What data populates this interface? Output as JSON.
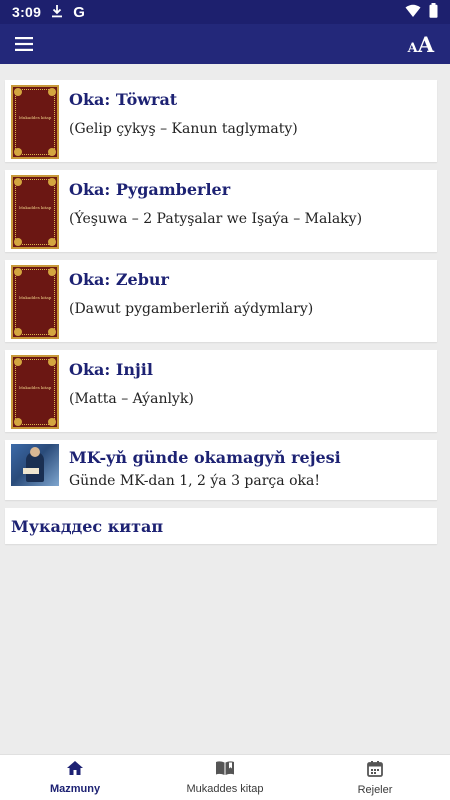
{
  "status_bar": {
    "time": "3:09",
    "icons": [
      "download-icon",
      "google-g-icon",
      "wifi-icon",
      "battery-icon"
    ],
    "g_letter": "G"
  },
  "app_bar": {
    "menu_icon": "hamburger-menu-icon",
    "font_size_small": "A",
    "font_size_big": "A"
  },
  "colors": {
    "primary": "#23287a",
    "status": "#1d206e",
    "title_text": "#1d2273",
    "background": "#ececec"
  },
  "cards": [
    {
      "title": "Oka: Töwrat",
      "subtitle": "(Gelip çykyş – Kanun taglymaty)",
      "cover_text": "Mukaddes kitap"
    },
    {
      "title": "Oka: Pygamberler",
      "subtitle": "(Ýeşuwa – 2 Patyşalar we Işaýa – Malaky)",
      "cover_text": "Mukaddes kitap"
    },
    {
      "title": "Oka: Zebur",
      "subtitle": "(Dawut pygamberleriň aýdymlary)",
      "cover_text": "Mukaddes kitap"
    },
    {
      "title": "Oka: Injil",
      "subtitle": "(Matta – Aýanlyk)",
      "cover_text": "Mukaddes kitap"
    }
  ],
  "plan_card": {
    "title": "MK-yň günde okamagyň rejesi",
    "subtitle": "Günde MK-dan 1, 2 ýa 3 parça oka!"
  },
  "cyrillic_card": {
    "title": "Мукаддес китап"
  },
  "bottom_nav": [
    {
      "label": "Mazmuny",
      "icon": "home-icon",
      "active": true
    },
    {
      "label": "Mukaddes kitap",
      "icon": "open-book-icon",
      "active": false
    },
    {
      "label": "Rejeler",
      "icon": "calendar-icon",
      "active": false
    }
  ]
}
